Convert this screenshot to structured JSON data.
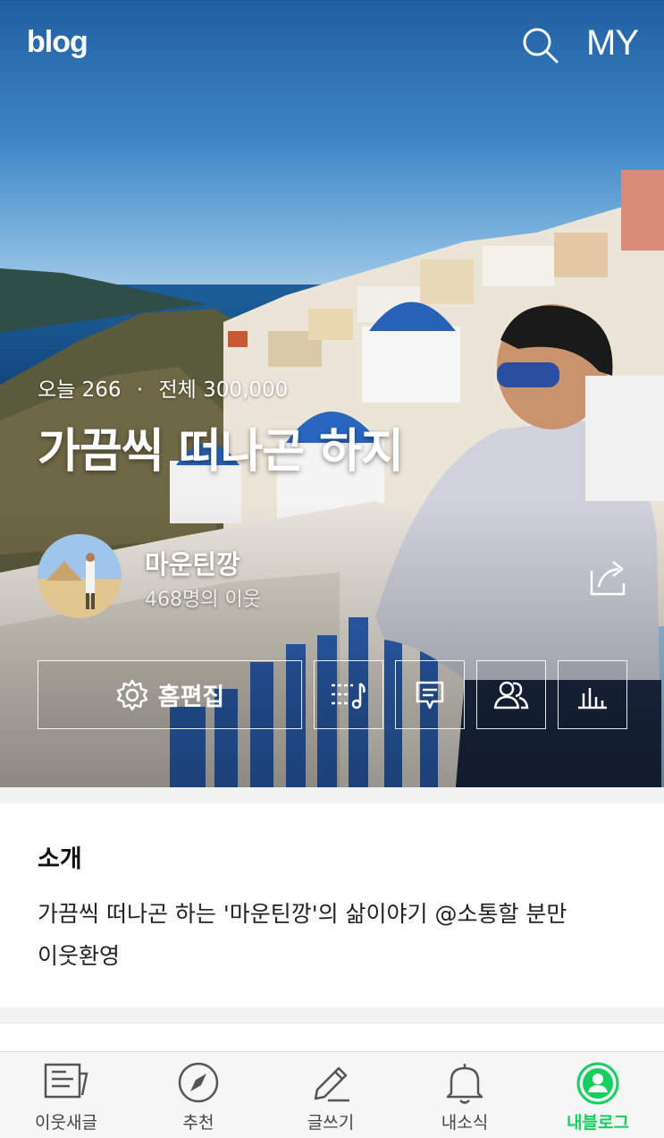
{
  "header": {
    "logo": "blog",
    "my_label": "MY"
  },
  "stats": {
    "today_label": "오늘",
    "today_value": "266",
    "total_label": "전체",
    "total_value": "300,000"
  },
  "blog_title": "가끔씩 떠나곤 하지",
  "profile": {
    "nickname": "마운틴깡",
    "neighbors": "468명의 이웃"
  },
  "actions": {
    "home_edit_label": "홈편집"
  },
  "intro": {
    "heading": "소개",
    "text_line1": "가끔씩 떠나곤 하는 '마운틴깡'의 삶이야기  @소통할 분만",
    "text_line2": "이웃환영"
  },
  "tabs": [
    {
      "label": "이웃새글",
      "icon": "news-feed-icon"
    },
    {
      "label": "추천",
      "icon": "compass-icon"
    },
    {
      "label": "글쓰기",
      "icon": "pencil-icon"
    },
    {
      "label": "내소식",
      "icon": "bell-icon"
    },
    {
      "label": "내블로그",
      "icon": "profile-icon"
    }
  ],
  "colors": {
    "accent": "#19ce60"
  }
}
